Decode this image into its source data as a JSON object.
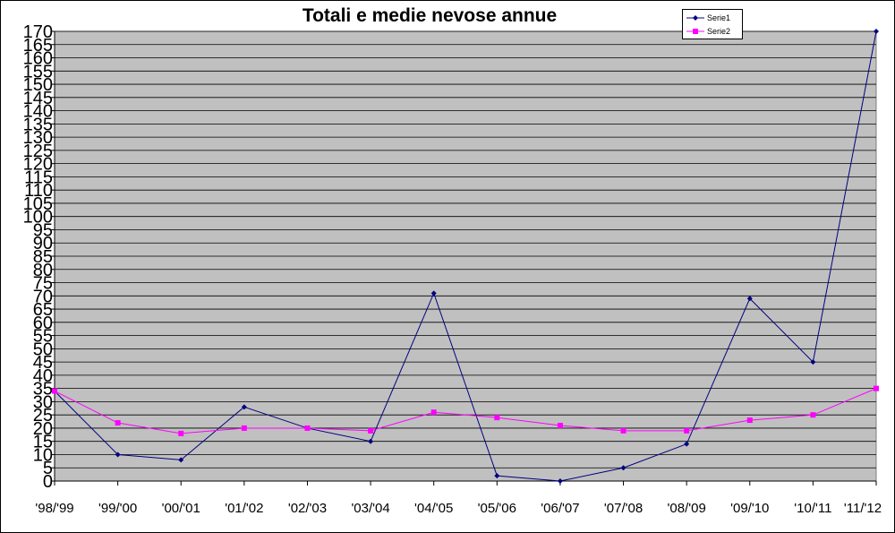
{
  "chart_data": {
    "type": "line",
    "title": "Totali e medie nevose annue",
    "xlabel": "",
    "ylabel": "",
    "categories": [
      "'98/'99",
      "'99/'00",
      "'00/'01",
      "'01/'02",
      "'02/'03",
      "'03/'04",
      "'04/'05",
      "'05/'06",
      "'06/'07",
      "'07/'08",
      "'08/'09",
      "'09/'10",
      "'10/'11",
      "'11/'12"
    ],
    "ylim": [
      0,
      170
    ],
    "ytick_step": 5,
    "grid": true,
    "legend_position": "top-right",
    "plot_background": "#c0c0c0",
    "series": [
      {
        "name": "Serie1",
        "color": "#000080",
        "marker": "diamond",
        "values": [
          34,
          10,
          8,
          28,
          20,
          15,
          71,
          2,
          0,
          5,
          14,
          69,
          45,
          170
        ]
      },
      {
        "name": "Serie2",
        "color": "#ff00ff",
        "marker": "square",
        "values": [
          34,
          22,
          18,
          20,
          20,
          19,
          26,
          24,
          21,
          19,
          19,
          23,
          25,
          35
        ]
      }
    ]
  }
}
